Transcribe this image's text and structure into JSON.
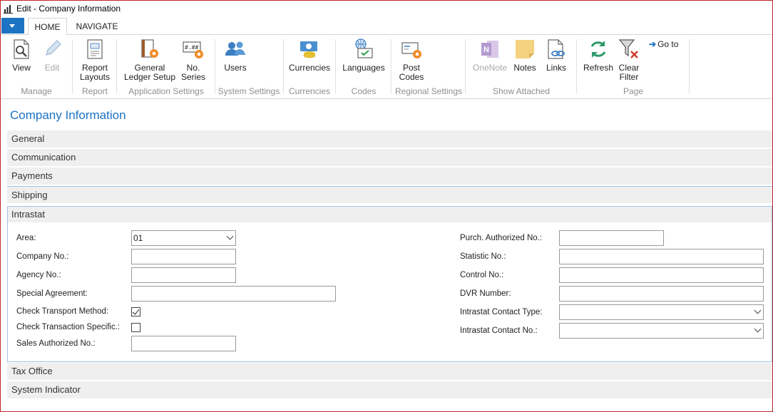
{
  "window": {
    "title": "Edit - Company Information"
  },
  "tabs": {
    "home": "HOME",
    "navigate": "NAVIGATE"
  },
  "ribbon": {
    "buttons": {
      "view": "View",
      "edit": "Edit",
      "report_layouts_1": "Report",
      "report_layouts_2": "Layouts",
      "gls_1": "General",
      "gls_2": "Ledger Setup",
      "noseries_1": "No.",
      "noseries_2": "Series",
      "users": "Users",
      "currencies": "Currencies",
      "languages": "Languages",
      "postcodes_1": "Post",
      "postcodes_2": "Codes",
      "onenote": "OneNote",
      "notes": "Notes",
      "links": "Links",
      "refresh": "Refresh",
      "clearfilter_1": "Clear",
      "clearfilter_2": "Filter",
      "goto": "Go to"
    },
    "groups": {
      "manage": "Manage",
      "report": "Report",
      "application_settings": "Application Settings",
      "system_settings": "System Settings",
      "currencies": "Currencies",
      "codes": "Codes",
      "regional_settings": "Regional Settings",
      "show_attached": "Show Attached",
      "page": "Page"
    }
  },
  "page": {
    "title": "Company Information",
    "sections": {
      "general": "General",
      "communication": "Communication",
      "payments": "Payments",
      "shipping": "Shipping",
      "intrastat": "Intrastat",
      "tax_office": "Tax Office",
      "system_indicator": "System Indicator"
    }
  },
  "intrastat": {
    "left": {
      "area_label": "Area:",
      "area_value": "01",
      "company_no_label": "Company No.:",
      "company_no_value": "",
      "agency_no_label": "Agency No.:",
      "agency_no_value": "",
      "special_agreement_label": "Special Agreement:",
      "special_agreement_value": "",
      "check_transport_label": "Check Transport Method:",
      "check_transport_checked": true,
      "check_transaction_label": "Check Transaction Specific.:",
      "check_transaction_checked": false,
      "sales_authorized_label": "Sales Authorized No.:",
      "sales_authorized_value": ""
    },
    "right": {
      "purch_authorized_label": "Purch. Authorized No.:",
      "purch_authorized_value": "",
      "statistic_no_label": "Statistic No.:",
      "statistic_no_value": "",
      "control_no_label": "Control No.:",
      "control_no_value": "",
      "dvr_number_label": "DVR Number:",
      "dvr_number_value": "",
      "contact_type_label": "Intrastat Contact Type:",
      "contact_type_value": "",
      "contact_no_label": "Intrastat Contact No.:",
      "contact_no_value": ""
    }
  },
  "colors": {
    "accent": "#1c73c4",
    "window_border": "#c0282d",
    "section_bg": "#efefef",
    "focus_border": "#9cc3e8"
  }
}
